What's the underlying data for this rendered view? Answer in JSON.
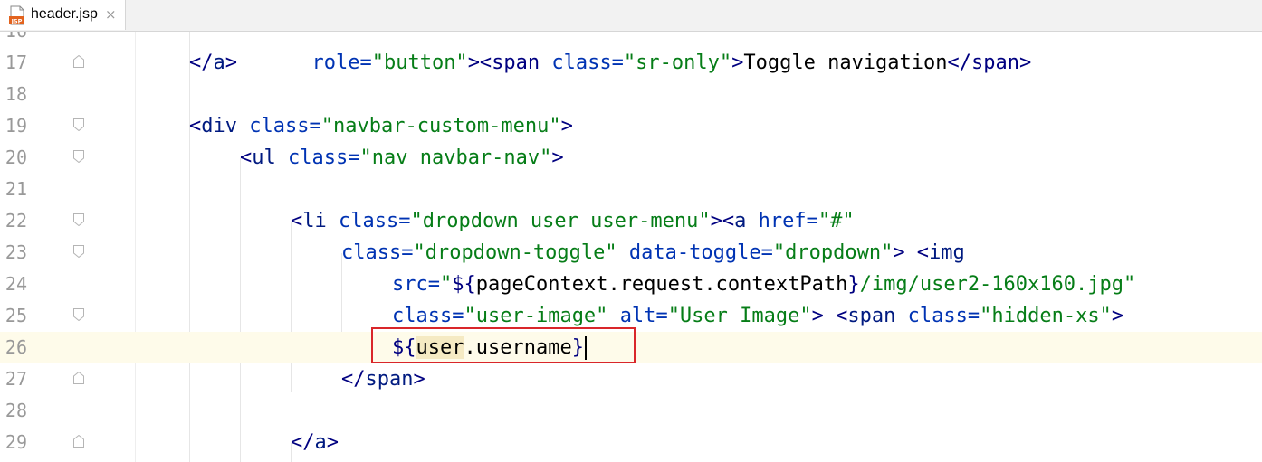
{
  "tab": {
    "title": "header.jsp",
    "icon": "jsp-file-icon",
    "icon_label": "JSP",
    "close": "×"
  },
  "colors": {
    "tag": "#000080",
    "attribute": "#0033b3",
    "string": "#067d17",
    "line_number": "#999999",
    "current_line": "#fefbea",
    "highlight_box": "#d9262a"
  },
  "lines": [
    {
      "num": "16",
      "parts": [
        "role=\"button\"><span class=\"sr-only\">Toggle navigation</span>"
      ]
    },
    {
      "num": "17",
      "parts": [
        "</",
        "a",
        ">"
      ]
    },
    {
      "num": "18",
      "parts": []
    },
    {
      "num": "19",
      "parts": [
        "<",
        "div",
        " ",
        "class",
        "=",
        "\"navbar-custom-menu\"",
        ">"
      ]
    },
    {
      "num": "20",
      "parts": [
        "<",
        "ul",
        " ",
        "class",
        "=",
        "\"nav navbar-nav\"",
        ">"
      ]
    },
    {
      "num": "21",
      "parts": []
    },
    {
      "num": "22",
      "parts": [
        "<",
        "li",
        " ",
        "class",
        "=",
        "\"dropdown user user-menu\"",
        "><",
        "a",
        " ",
        "href",
        "=",
        "\"#\""
      ]
    },
    {
      "num": "23",
      "parts": [
        "class",
        "=",
        "\"dropdown-toggle\"",
        " ",
        "data-toggle",
        "=",
        "\"dropdown\"",
        "> <",
        "img"
      ]
    },
    {
      "num": "24",
      "parts": [
        "src",
        "=",
        "\"",
        "${",
        "pageContext.request.contextPath",
        "}",
        "/img/user2-160x160.jpg\""
      ]
    },
    {
      "num": "25",
      "parts": [
        "class",
        "=",
        "\"user-image\"",
        " ",
        "alt",
        "=",
        "\"User Image\"",
        "> <",
        "span",
        " ",
        "class",
        "=",
        "\"hidden-xs\"",
        ">"
      ]
    },
    {
      "num": "26",
      "parts": [
        "${",
        "user",
        ".username",
        "}"
      ]
    },
    {
      "num": "27",
      "parts": [
        "</",
        "span",
        ">"
      ]
    },
    {
      "num": "28",
      "parts": []
    },
    {
      "num": "29",
      "parts": [
        "</",
        "a",
        ">"
      ]
    }
  ]
}
